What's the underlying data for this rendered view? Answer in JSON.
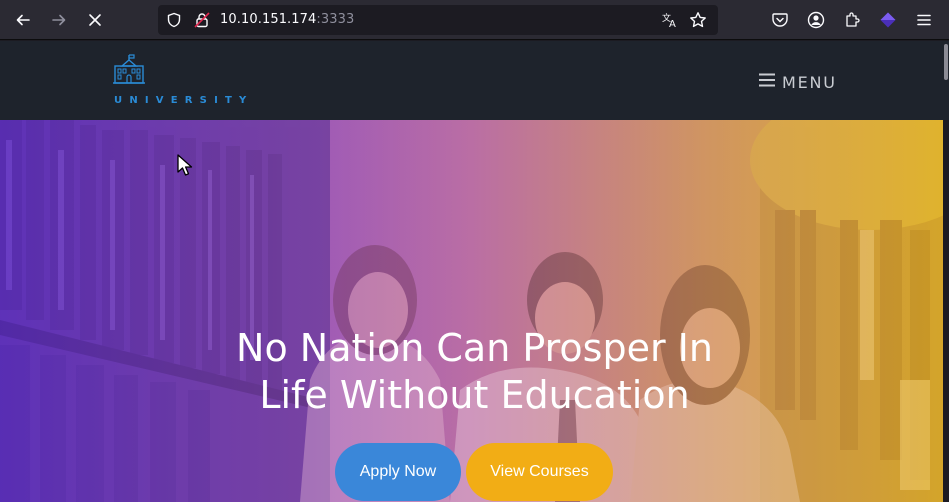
{
  "browser": {
    "url_host": "10.10.151.174",
    "url_port": ":3333",
    "icons": [
      "back-icon",
      "forward-icon",
      "stop-icon",
      "shield-icon",
      "lock-icon",
      "translate-icon",
      "star-icon",
      "pocket-icon",
      "account-icon",
      "extensions-icon",
      "extension-purple-icon",
      "hamburger-icon"
    ]
  },
  "site": {
    "logo_text": "UNIVERSITY",
    "menu_label": "MENU"
  },
  "hero": {
    "title_line1": "No Nation Can Prosper In",
    "title_line2": "Life Without Education",
    "apply_label": "Apply Now",
    "courses_label": "View Courses"
  },
  "colors": {
    "brand_blue": "#2a8bd6",
    "apply_button": "#3a87d9",
    "courses_button": "#f2ad15",
    "header_bg": "#1e232c",
    "gradient_start": "#6c3fc8",
    "gradient_end": "#d6b036"
  }
}
